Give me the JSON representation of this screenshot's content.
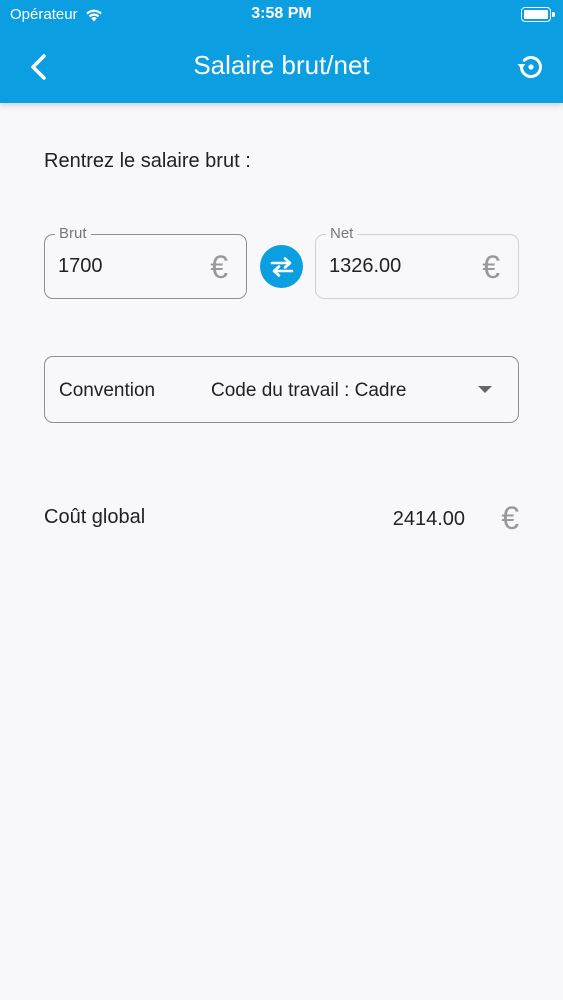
{
  "status_bar": {
    "carrier": "Opérateur",
    "time": "3:58 PM"
  },
  "header": {
    "title": "Salaire brut/net",
    "back_icon": "chevron-left-icon",
    "reset_icon": "history-reset-icon",
    "color": "#0b9fe2"
  },
  "form": {
    "prompt": "Rentrez le salaire brut :",
    "brut": {
      "label": "Brut",
      "value": "1700",
      "currency": "€"
    },
    "net": {
      "label": "Net",
      "value": "1326.00",
      "currency": "€"
    },
    "swap_icon": "swap-arrows-icon"
  },
  "convention": {
    "label": "Convention",
    "selected": "Code du travail : Cadre"
  },
  "cost": {
    "label": "Coût global",
    "value": "2414.00",
    "currency": "€"
  }
}
